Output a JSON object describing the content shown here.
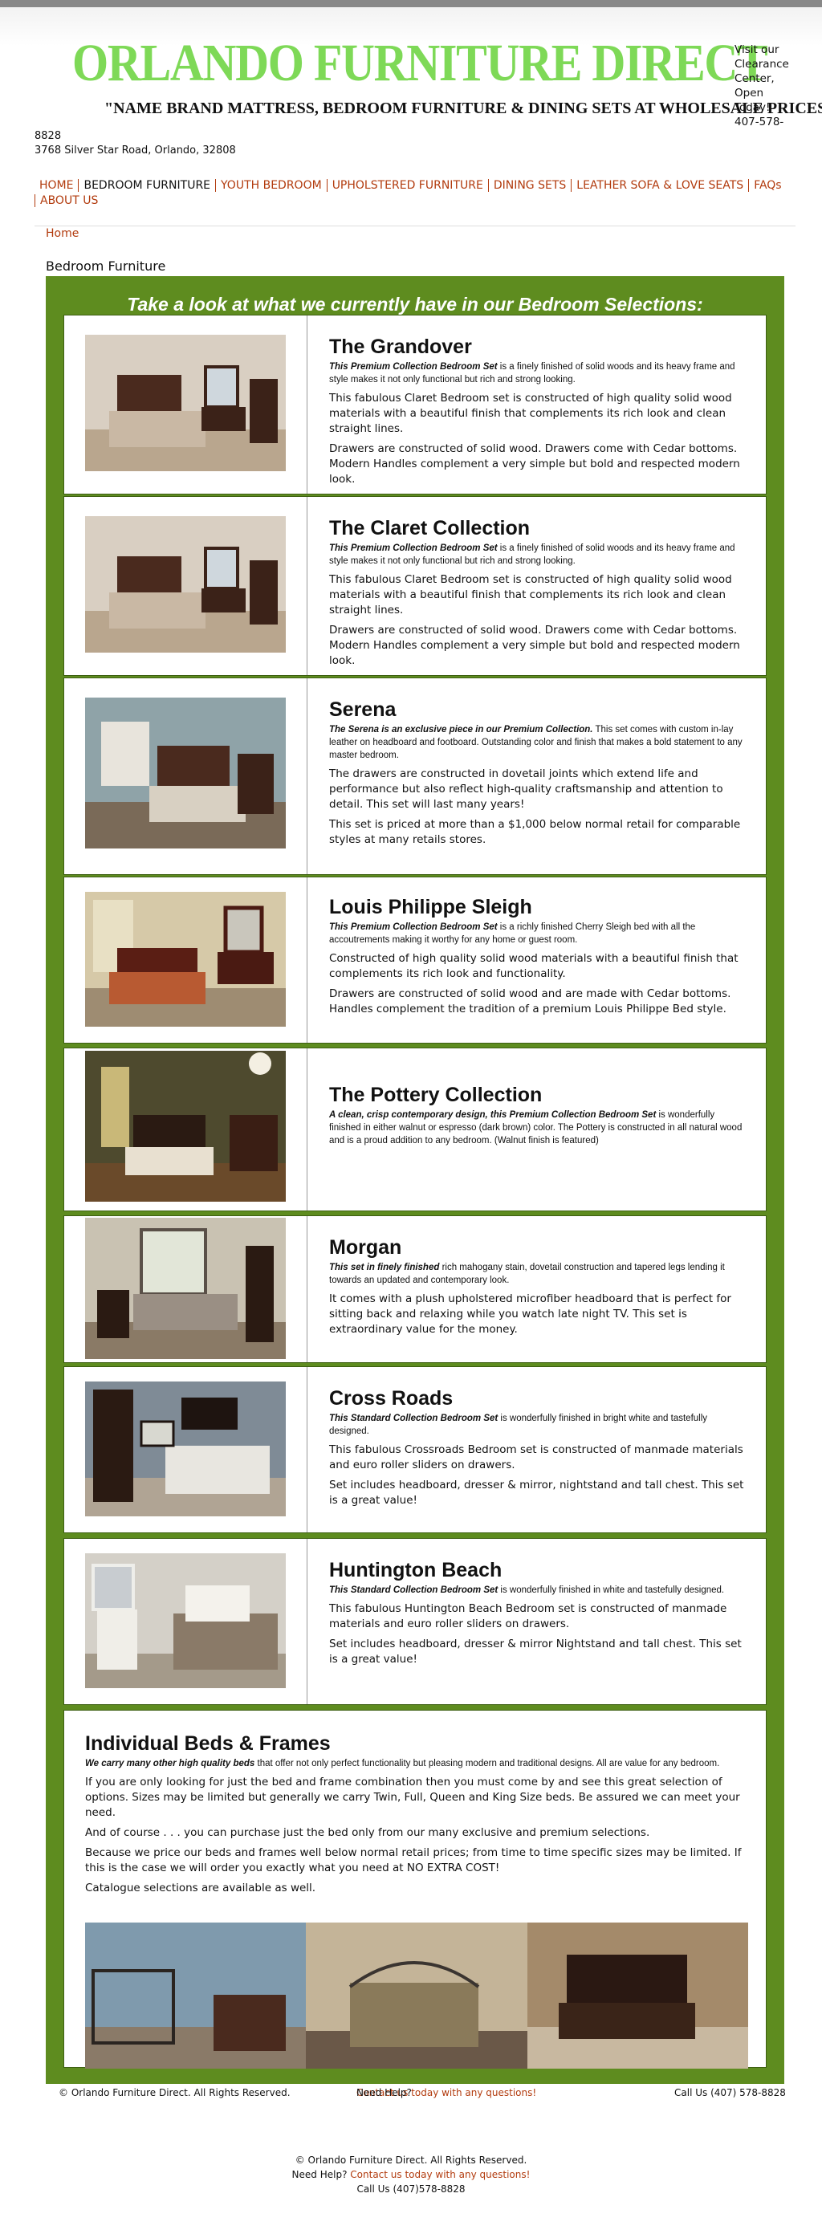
{
  "header": {
    "brand": "ORLANDO FURNITURE DIRECT",
    "tagline": "\"NAME BRAND MATTRESS, BEDROOM FURNITURE & DINING SETS AT WHOLESALE PRICES\"",
    "visit_text": "Visit our Clearance Center, Open Today! 407-578-",
    "address_line1": "8828",
    "address_line2": "3768 Silver Star Road, Orlando, 32808"
  },
  "nav": {
    "items": [
      "HOME",
      "BEDROOM FURNITURE",
      "YOUTH BEDROOM",
      "UPHOLSTERED FURNITURE",
      "DINING SETS",
      "LEATHER SOFA & LOVE SEATS",
      "FAQs"
    ],
    "row2": "ABOUT US"
  },
  "breadcrumb": "Home",
  "page_title": "Bedroom Furniture",
  "panel_title": "Take a look at what we currently have in our Bedroom Selections:",
  "products": [
    {
      "name": "The Grandover",
      "lead_bold": "This Premium Collection Bedroom Set",
      "lead_rest": " is a finely finished of solid woods and its heavy frame and style makes it not only functional but rich and strong looking.",
      "p1": "This fabulous Claret Bedroom set is constructed of high quality solid wood materials with a beautiful finish that complements its rich look and clean straight lines.",
      "p2": "Drawers are constructed of solid wood. Drawers come with Cedar bottoms. Modern Handles complement a very simple but bold and respected modern look."
    },
    {
      "name": "The Claret Collection",
      "lead_bold": "This Premium Collection Bedroom Set",
      "lead_rest": " is a finely finished of solid woods and its heavy frame and style makes it not only functional but rich and strong looking.",
      "p1": "This fabulous Claret Bedroom set is constructed of high quality solid wood materials with a beautiful finish that complements its rich look and clean straight lines.",
      "p2": "Drawers are constructed of solid wood. Drawers come with Cedar bottoms. Modern Handles complement a very simple but bold and respected modern look."
    },
    {
      "name": "Serena",
      "lead_bold": "The Serena is an exclusive piece in our Premium Collection.",
      "lead_rest": "  This set comes with custom in-lay leather on headboard and footboard.  Outstanding color and finish that makes a bold statement to any master bedroom.",
      "p1": "The drawers are constructed in dovetail joints which extend life and performance but also reflect high-quality craftsmanship and attention to detail. This set will last many years!",
      "p2": "This set is priced at more than a $1,000 below normal retail for comparable styles at many retails stores."
    },
    {
      "name": "Louis Philippe Sleigh",
      "lead_bold": "This Premium Collection Bedroom Set",
      "lead_rest": " is a richly finished Cherry Sleigh bed with all the accoutrements making it worthy for any home or guest room.",
      "p1": "Constructed of high quality solid wood materials with a beautiful finish that complements its rich look and functionality.",
      "p2": "Drawers are constructed of solid wood and are made with Cedar bottoms. Handles complement the tradition of a premium Louis Philippe Bed style."
    },
    {
      "name": "The Pottery Collection",
      "lead_bold": "A clean, crisp contemporary design, this Premium Collection Bedroom Set",
      "lead_rest": " is wonderfully finished in either walnut or espresso (dark brown) color. The Pottery is constructed in all natural wood and is a proud addition to any bedroom. (Walnut finish is featured)",
      "p1": "",
      "p2": ""
    },
    {
      "name": "Morgan",
      "lead_bold": "This set in finely finished",
      "lead_rest": " rich mahogany stain, dovetail construction and tapered legs lending it towards an updated and contemporary look.",
      "p1": "It comes with a plush upholstered microfiber headboard that is perfect for sitting back and relaxing while you watch late night TV. This set is extraordinary value for the money.",
      "p2": ""
    },
    {
      "name": "Cross Roads",
      "lead_bold": "This Standard Collection Bedroom Set",
      "lead_rest": " is wonderfully finished in bright white and tastefully designed.",
      "p1": "This fabulous Crossroads Bedroom set is constructed of manmade materials and euro roller sliders on drawers.",
      "p2": "Set includes headboard, dresser & mirror, nightstand and tall chest. This set is a great value!"
    },
    {
      "name": "Huntington Beach",
      "lead_bold": "This Standard Collection Bedroom Set",
      "lead_rest": " is wonderfully finished in white and tastefully designed.",
      "p1": "This fabulous Huntington Beach Bedroom set is constructed of manmade materials and euro roller sliders on drawers.",
      "p2": "Set includes headboard, dresser & mirror Nightstand and tall chest. This set is a great value!"
    }
  ],
  "frames": {
    "title": "Individual Beds & Frames",
    "lead_bold": "We carry many other high quality beds",
    "lead_rest": " that offer not only perfect functionality but pleasing modern and traditional designs. All are value for any bedroom.",
    "p1": "If you are only looking for just the bed and frame combination then you must come by and see this great selection of options. Sizes may be limited but generally we carry Twin, Full, Queen and King Size beds. Be assured we can meet your need.",
    "p2": "And of course . . . you can purchase just the bed only from our many exclusive and premium selections.",
    "p3": "Because we price our beds and frames well below normal retail prices; from time to time specific sizes may be limited. If this is the case we will order you exactly what you need at NO EXTRA COST!",
    "p4": "Catalogue selections are available as well."
  },
  "footer": {
    "copyright": "© Orlando Furniture Direct. All Rights Reserved.",
    "help": "Need Help?",
    "contact_link": "Contact us today with any questions!",
    "call": "Call Us (407) 578-8828",
    "call2": "Call Us (407)578-8828"
  },
  "colors": {
    "brand_green": "#7ed957",
    "panel_green": "#5e8c1f",
    "link_red": "#b23b0e"
  }
}
